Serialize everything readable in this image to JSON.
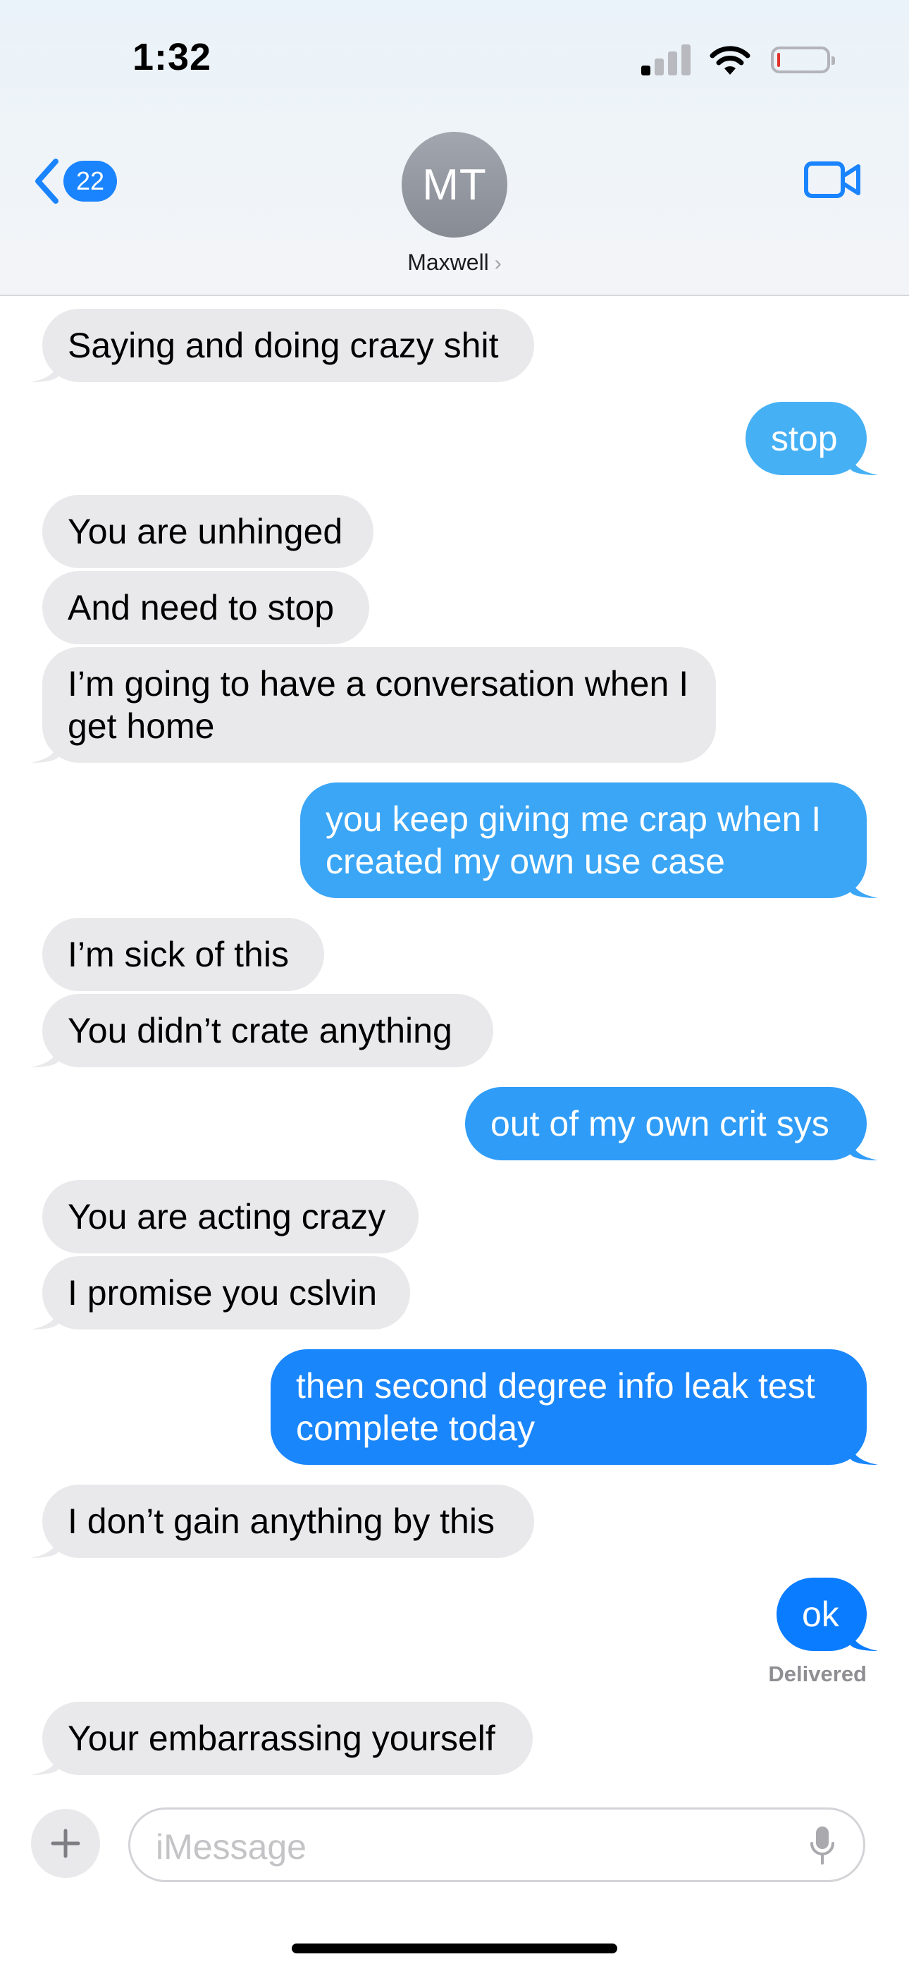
{
  "status_bar": {
    "time": "1:32"
  },
  "header": {
    "unread_count": "22",
    "avatar_initials": "MT",
    "contact_name": "Maxwell",
    "chevron": "›"
  },
  "messages": [
    {
      "text": "Saying and doing crazy shit",
      "from": "them"
    },
    {
      "text": "stop",
      "from": "me"
    },
    {
      "text": "You are unhinged",
      "from": "them"
    },
    {
      "text": "And need to stop",
      "from": "them"
    },
    {
      "text": "I’m going to have a conversation when I get home",
      "from": "them"
    },
    {
      "text": "you keep giving me crap when I created my own use case",
      "from": "me"
    },
    {
      "text": "I’m sick of this",
      "from": "them"
    },
    {
      "text": "You didn’t crate anything",
      "from": "them"
    },
    {
      "text": "out of my own crit sys",
      "from": "me"
    },
    {
      "text": "You are acting crazy",
      "from": "them"
    },
    {
      "text": "I promise you cslvin",
      "from": "them"
    },
    {
      "text": "then second degree info leak test complete today",
      "from": "me"
    },
    {
      "text": "I don’t gain anything by this",
      "from": "them"
    },
    {
      "text": "ok",
      "from": "me"
    },
    {
      "text": "Your embarrassing yourself",
      "from": "them"
    }
  ],
  "delivered_label": "Delivered",
  "composer": {
    "placeholder": "iMessage"
  },
  "icons": {
    "back": "chevron-left-icon",
    "video": "video-camera-icon",
    "plus": "plus-icon",
    "mic": "microphone-icon",
    "signal": "cellular-signal-icon",
    "wifi": "wifi-icon",
    "battery": "battery-low-icon"
  },
  "colors": {
    "accent": "#1a84ff",
    "incoming_bubble": "#e9e9eb",
    "outgoing_bubble_top": "#46b0f5",
    "outgoing_bubble_bottom": "#0a7cff",
    "battery_low": "#e0332c"
  }
}
